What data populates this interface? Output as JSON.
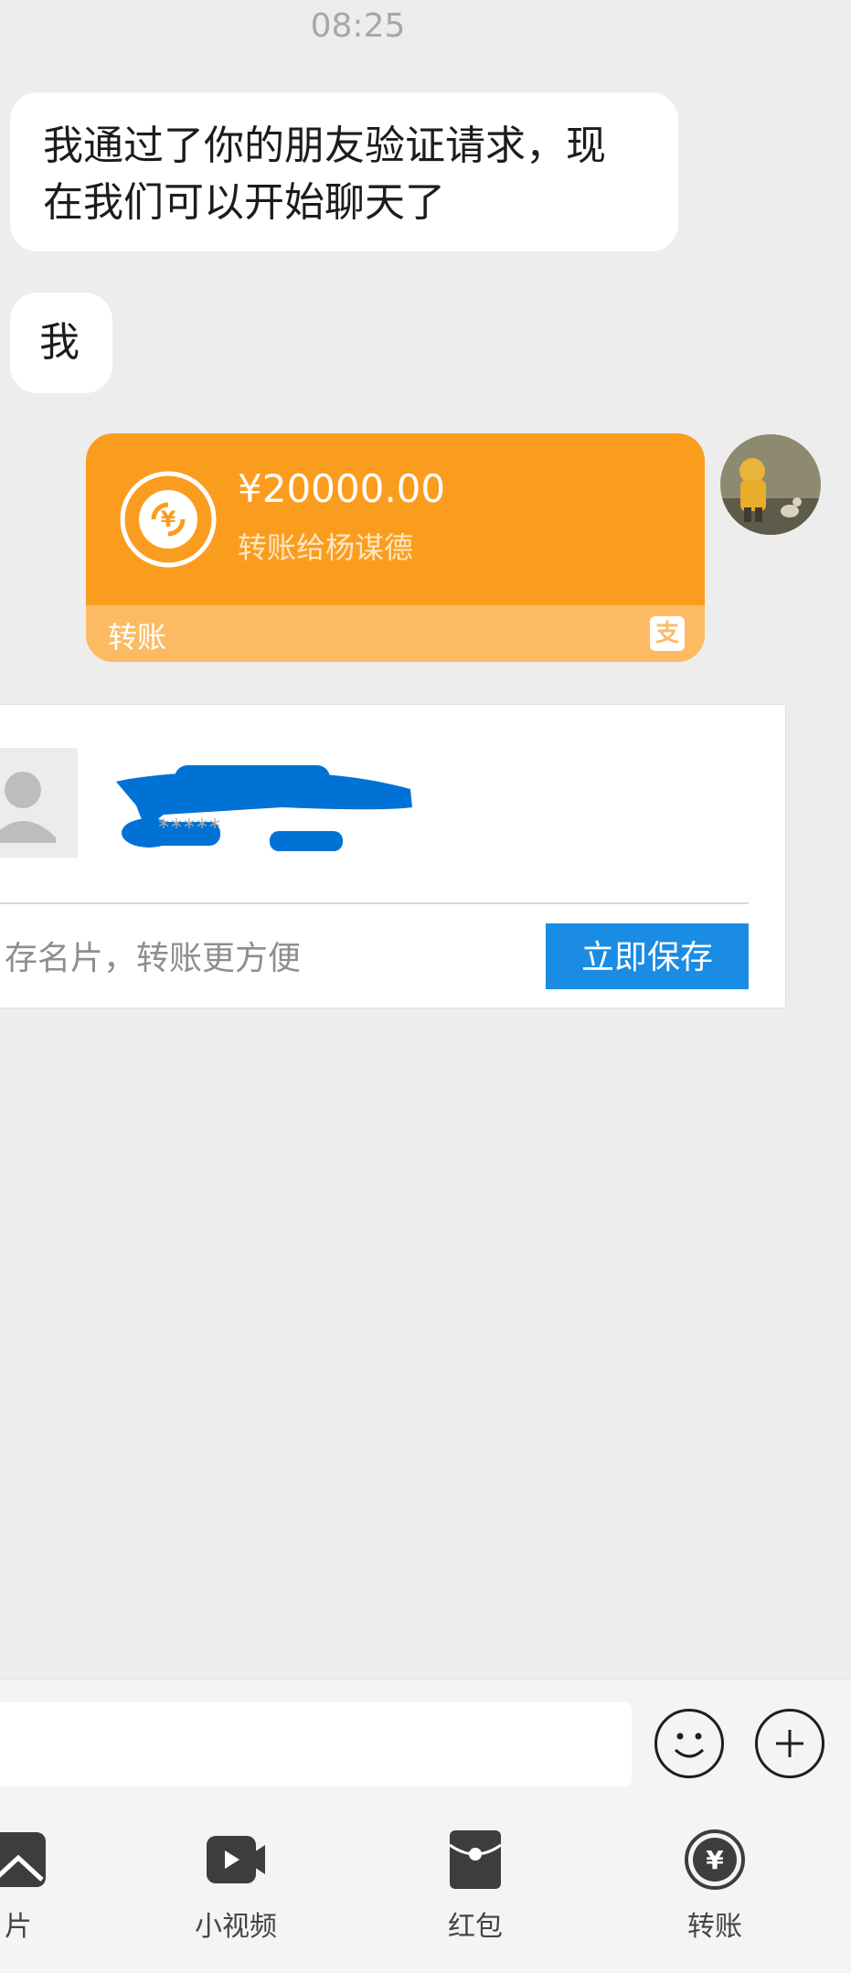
{
  "chat": {
    "timestamp": "08:25",
    "messages": [
      {
        "text": "我通过了你的朋友验证请求，现在我们可以开始聊天了"
      },
      {
        "text": "我"
      }
    ]
  },
  "transfer": {
    "amount": "¥20000.00",
    "description": "转账给杨谋德",
    "type_label": "转账",
    "badge_icon": "alipay-icon"
  },
  "contact_card": {
    "account_masked": "*****",
    "hint": "存名片，转账更方便",
    "save_label": "立即保存"
  },
  "input_bar": {
    "emoji_icon": "smiley-icon",
    "plus_icon": "plus-circle-icon"
  },
  "panel": {
    "items": [
      {
        "label": "片",
        "icon": "image-icon"
      },
      {
        "label": "小视频",
        "icon": "video-camera-icon"
      },
      {
        "label": "红包",
        "icon": "red-packet-icon"
      },
      {
        "label": "转账",
        "icon": "transfer-icon"
      }
    ]
  },
  "colors": {
    "background": "#ededed",
    "transfer_orange": "#fa9d1e",
    "transfer_footer": "#fcbb63",
    "save_button": "#1a8ce4",
    "redaction_blue": "#0072d6"
  }
}
